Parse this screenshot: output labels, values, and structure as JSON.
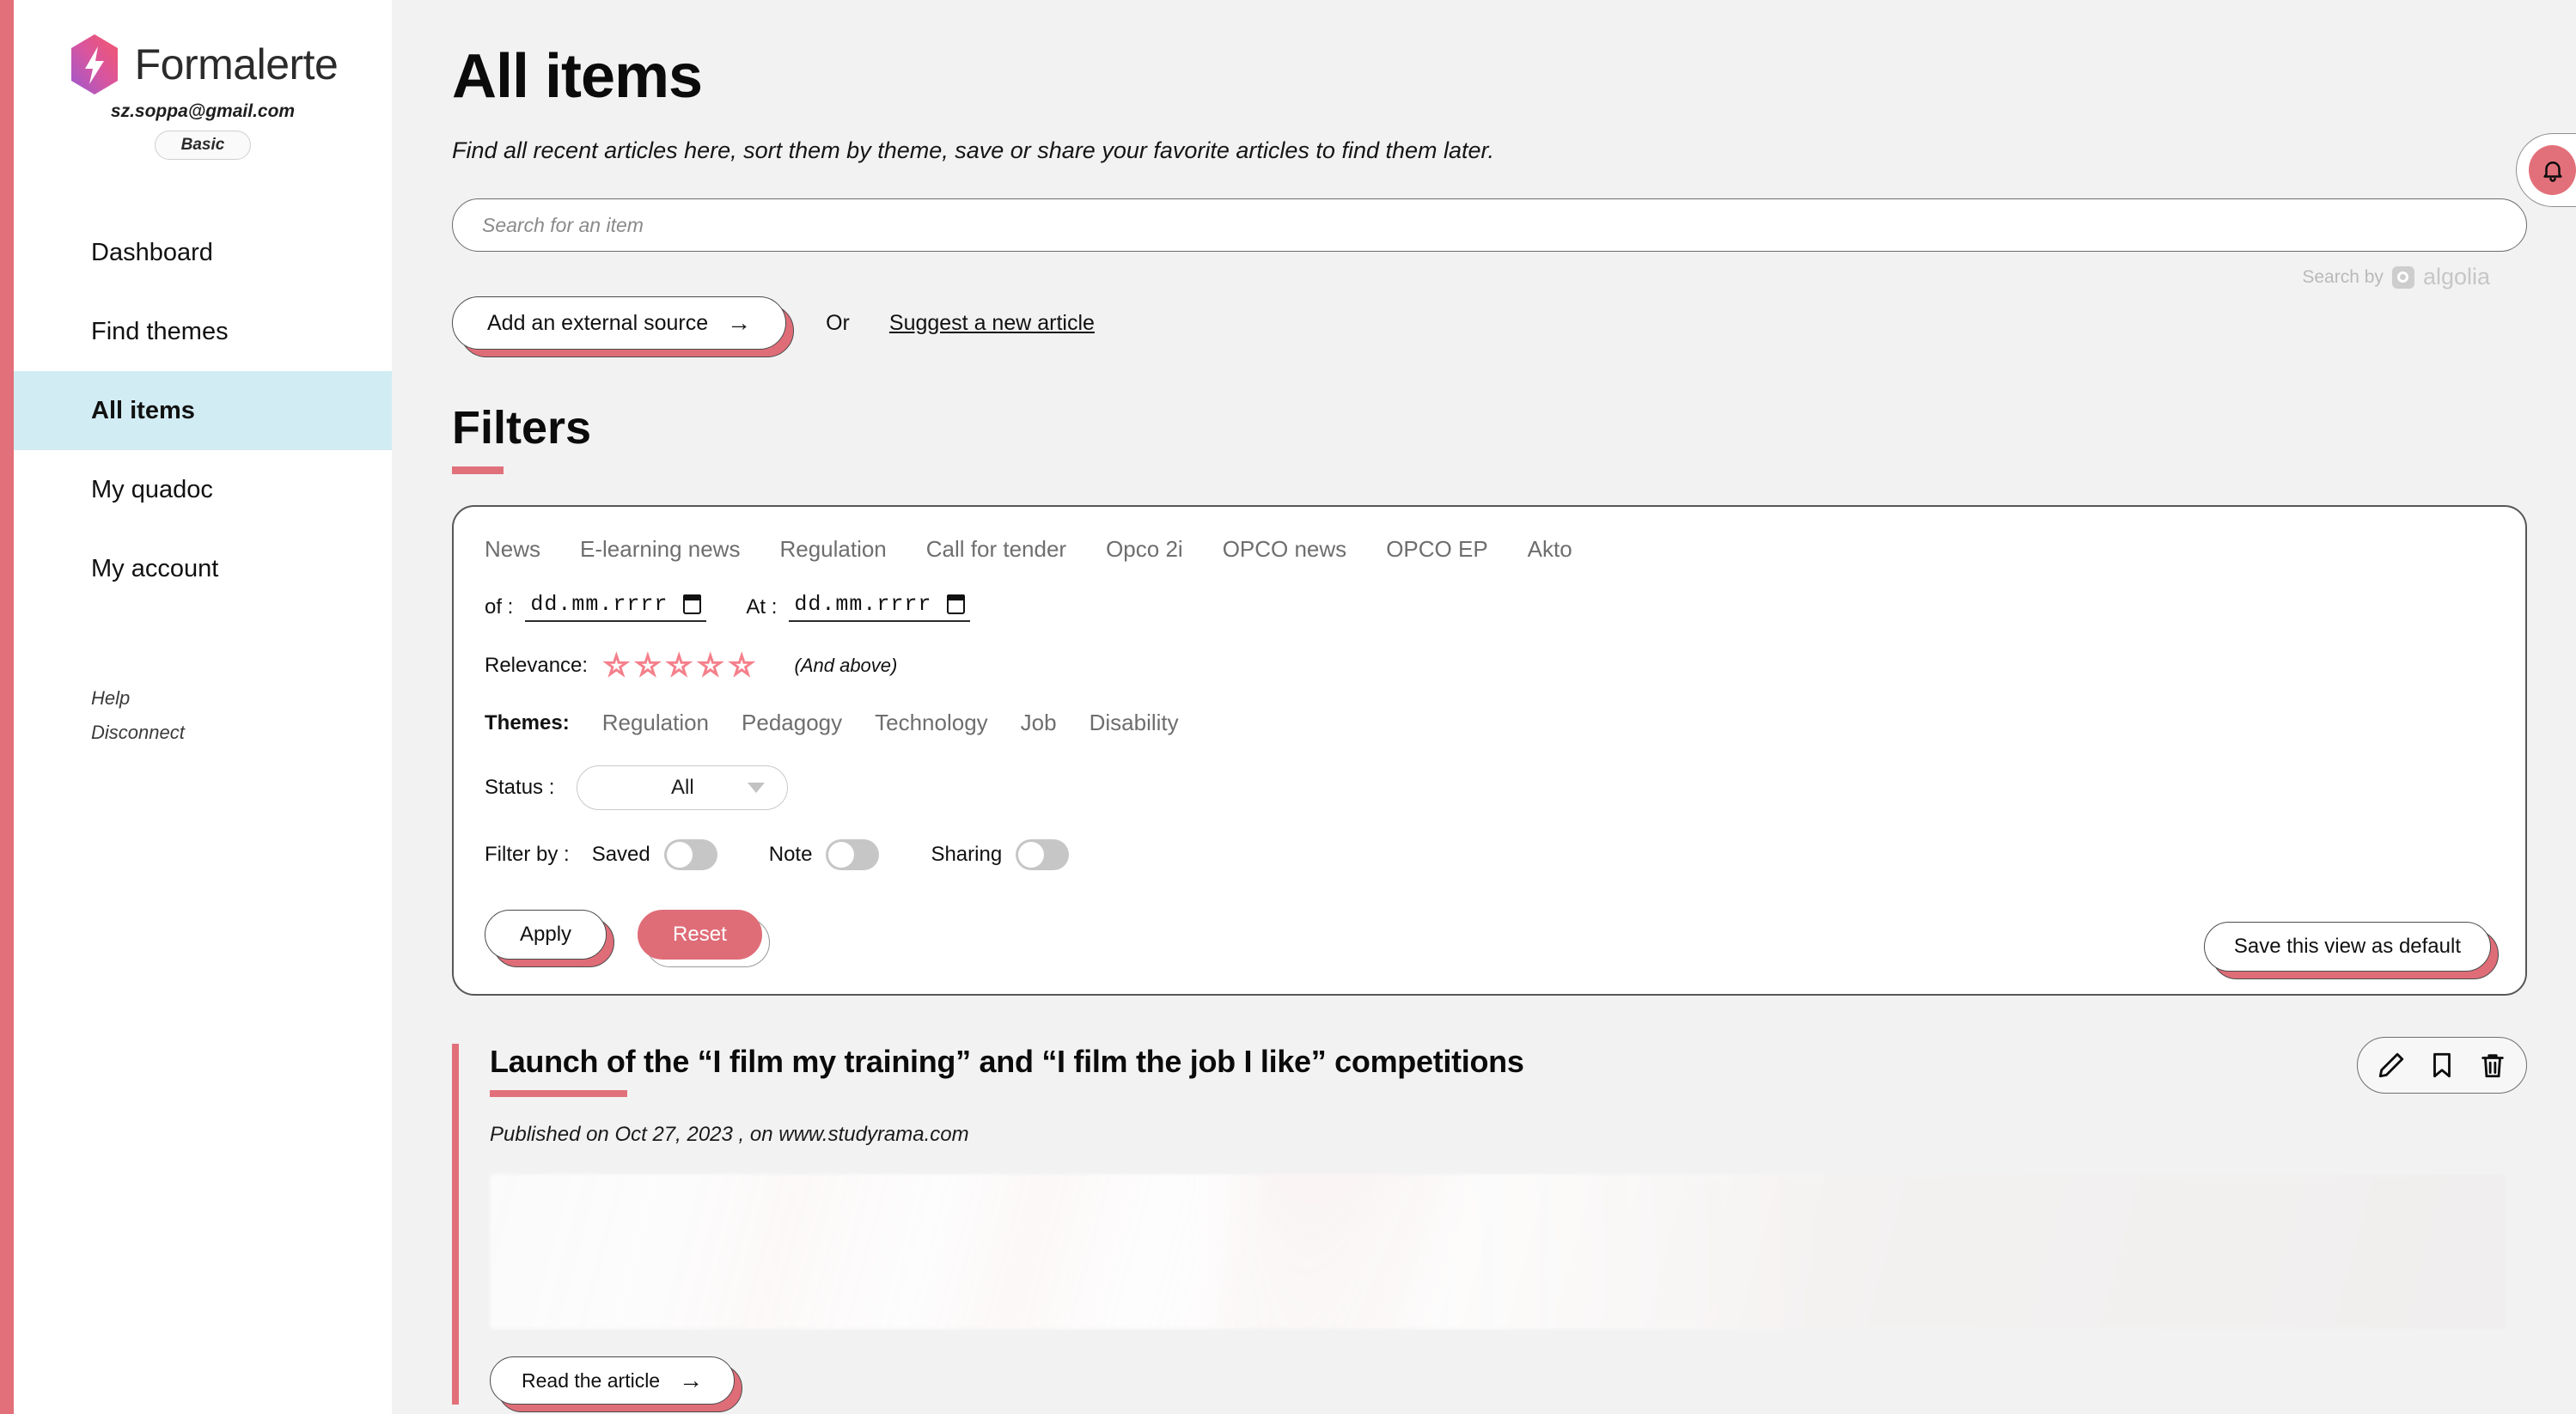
{
  "sidebar": {
    "brand_name": "Formalerte",
    "email": "sz.soppa@gmail.com",
    "plan": "Basic",
    "items": [
      {
        "label": "Dashboard"
      },
      {
        "label": "Find themes"
      },
      {
        "label": "All items"
      },
      {
        "label": "My quadoc"
      },
      {
        "label": "My account"
      }
    ],
    "footer": [
      {
        "label": "Help"
      },
      {
        "label": "Disconnect"
      }
    ]
  },
  "header": {
    "title": "All items",
    "subtitle": "Find all recent articles here, sort them by theme, save or share your favorite articles to find them later."
  },
  "search": {
    "placeholder": "Search for an item",
    "value": "",
    "attribution_prefix": "Search by",
    "attribution_brand": "algolia"
  },
  "actions": {
    "external_source_label": "Add an external source",
    "external_source_arrow": "→",
    "or_label": "Or",
    "suggest_label": "Suggest a new article"
  },
  "filters": {
    "title": "Filters",
    "tabs": [
      {
        "label": "News"
      },
      {
        "label": "E-learning news"
      },
      {
        "label": "Regulation"
      },
      {
        "label": "Call for tender"
      },
      {
        "label": "Opco 2i"
      },
      {
        "label": "OPCO news"
      },
      {
        "label": "OPCO EP"
      },
      {
        "label": "Akto"
      }
    ],
    "date_from_label": "of :",
    "date_from_value": "dd.mm.rrrr",
    "date_to_label": "At :",
    "date_to_value": "dd.mm.rrrr",
    "relevance_label": "Relevance:",
    "relevance_stars": 5,
    "relevance_selected": 0,
    "relevance_note": "(And above)",
    "themes_label": "Themes:",
    "themes": [
      {
        "label": "Regulation"
      },
      {
        "label": "Pedagogy"
      },
      {
        "label": "Technology"
      },
      {
        "label": "Job"
      },
      {
        "label": "Disability"
      }
    ],
    "status_label": "Status :",
    "status_value": "All",
    "status_options": [
      "All"
    ],
    "filter_by_label": "Filter by :",
    "toggles": [
      {
        "label": "Saved",
        "on": false
      },
      {
        "label": "Note",
        "on": false
      },
      {
        "label": "Sharing",
        "on": false
      }
    ],
    "apply_label": "Apply",
    "reset_label": "Reset",
    "save_default_label": "Save this view as default"
  },
  "article": {
    "title": "Launch of the “I film my training” and “I film the job I like” competitions",
    "meta": "Published on Oct 27, 2023 , on www.studyrama.com",
    "read_label": "Read the article",
    "read_arrow": "→",
    "icons": [
      {
        "name": "edit-icon"
      },
      {
        "name": "bookmark-icon"
      },
      {
        "name": "delete-icon"
      }
    ]
  },
  "colors": {
    "accent": "#e2707a",
    "accent_button": "#df6d78",
    "active_nav": "#d2ecf3",
    "page_bg": "#f2f2f2"
  }
}
